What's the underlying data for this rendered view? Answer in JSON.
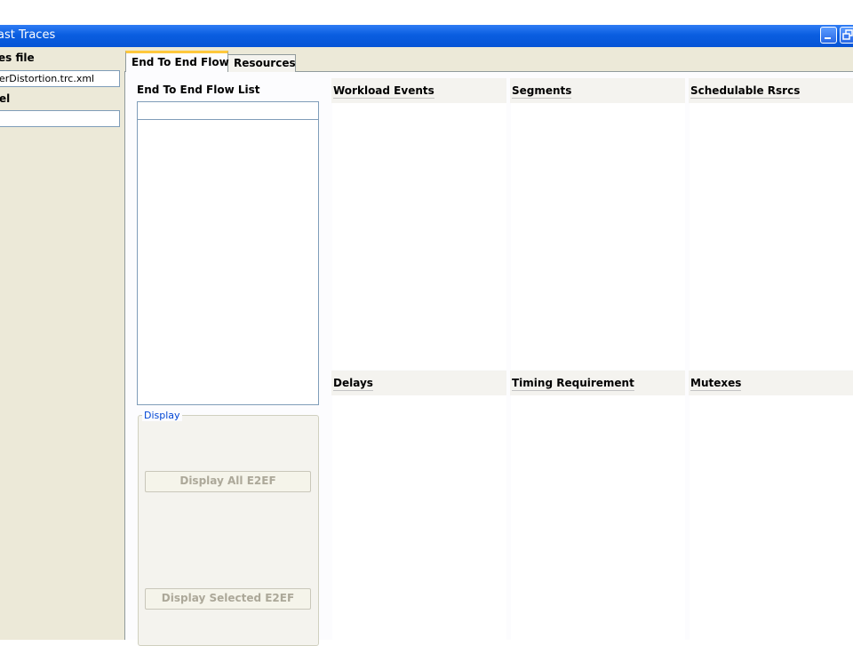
{
  "window": {
    "title": "ast Traces",
    "controls": {
      "minimize_icon": "minimize-icon",
      "restore_icon": "restore-icon"
    }
  },
  "left_panel": {
    "traces_label": "es file",
    "traces_value": "erDistortion.trc.xml",
    "second_label": "el",
    "second_value": ""
  },
  "tabs": [
    {
      "label": "End To End Flow",
      "selected": true
    },
    {
      "label": "Resources",
      "selected": false
    }
  ],
  "flow_list": {
    "label": "End To End Flow List",
    "filter_value": "",
    "items": []
  },
  "display": {
    "legend": "Display",
    "display_all": "Display All E2EF",
    "display_selected": "Display Selected E2EF"
  },
  "panes": {
    "workload_events": "Workload Events",
    "segments": "Segments",
    "schedulable_rsrcs": "Schedulable Rsrcs",
    "delays": "Delays",
    "timing_requirement": "Timing Requirement",
    "mutexes": "Mutexes"
  },
  "colors": {
    "titlebar": "#0a5ee0",
    "active_tab_accent": "#ffc83c",
    "window_face": "#ece9d8",
    "legend_text": "#0046d5"
  }
}
